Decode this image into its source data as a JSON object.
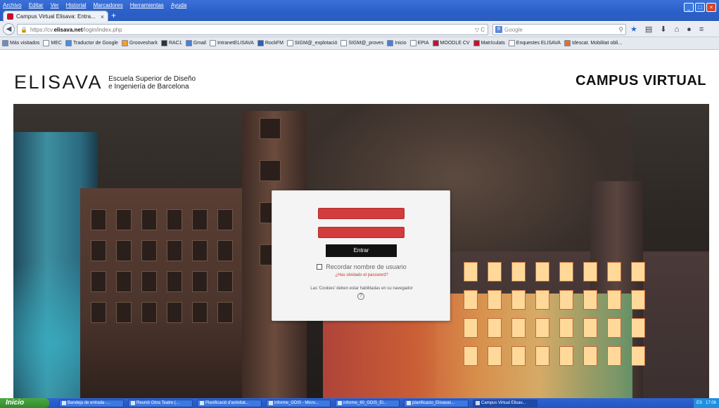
{
  "menu": [
    "Archivo",
    "Editar",
    "Ver",
    "Historial",
    "Marcadores",
    "Herramientas",
    "Ayuda"
  ],
  "tab": {
    "title": "Campus Virtual Elisava: Entra...",
    "close": "×",
    "new": "+"
  },
  "url": {
    "prefix": "https://cv.",
    "domain": "elisava.net",
    "path": "/login/index.php",
    "right": "▽ C"
  },
  "search": {
    "engine": "g-icon",
    "placeholder": "Google"
  },
  "bookmarks": [
    {
      "label": "Más visitados",
      "color": "#6a8fbf"
    },
    {
      "label": "MEC",
      "color": "#ffffff"
    },
    {
      "label": "Traductor de Google",
      "color": "#4a8fdc"
    },
    {
      "label": "Grooveshark",
      "color": "#f0a030"
    },
    {
      "label": "RAC1",
      "color": "#333333"
    },
    {
      "label": "Gmail",
      "color": "#4a7fd8"
    },
    {
      "label": "IntranetELISAVA",
      "color": "#ffffff"
    },
    {
      "label": "RockFM",
      "color": "#3060b0"
    },
    {
      "label": "SIGM@_explotació",
      "color": "#ffffff"
    },
    {
      "label": "SIGM@_proves",
      "color": "#ffffff"
    },
    {
      "label": "Inicio",
      "color": "#4a7fd8"
    },
    {
      "label": "EPIA",
      "color": "#ffffff"
    },
    {
      "label": "MOODLE CV",
      "color": "#c8102e"
    },
    {
      "label": "Matrículats",
      "color": "#c8102e"
    },
    {
      "label": "Enquestes ELISAVA",
      "color": "#ffffff"
    },
    {
      "label": "Idescat. Mobilitat obli...",
      "color": "#e07030"
    }
  ],
  "header": {
    "logo": "ELISAVA",
    "sub1": "Escuela Superior de Diseño",
    "sub2": "e Ingeniería de Barcelona",
    "campus": "CAMPUS VIRTUAL"
  },
  "login": {
    "button": "Entrar",
    "remember": "Recordar nombre de usuario",
    "forgot": "¿Has olvidado el password?",
    "cookies": "Las 'Cookies' deben estar habilitadas en su navegador",
    "help": "?"
  },
  "taskbar": {
    "start": "Inicio",
    "tasks": [
      "Bandeja de entrada -...",
      "Reunió Obra Teatre (...",
      "Planificació d'activitat...",
      "informe_GDIS - Micro...",
      "informe_60_GDIS_El...",
      "planificacio_Elisavas...",
      "Campus Virtual Elisav..."
    ],
    "lang": "ES",
    "clock": "17:06"
  },
  "colors": {
    "accent": "#d23c3c",
    "button": "#111111",
    "xp_blue": "#2556bf"
  }
}
